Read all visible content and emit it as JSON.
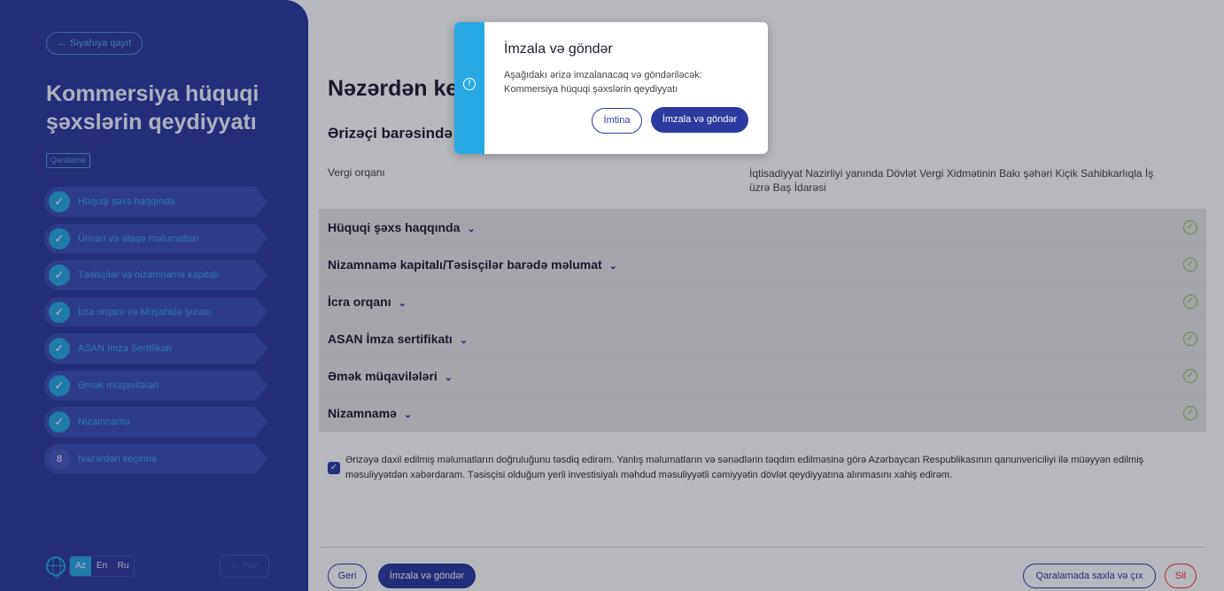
{
  "sidebar": {
    "back_label": "← Siyahıya qayıt",
    "title": "Kommersiya hüquqi şəxslərin qeydiyyatı",
    "badge": "Qaralama",
    "steps": [
      {
        "label": "Hüquqi şəxs haqqında",
        "done": true
      },
      {
        "label": "Ünvan və əlaqə məlumatları",
        "done": true
      },
      {
        "label": "Təsisçilər və nizamnamə kapitalı",
        "done": true
      },
      {
        "label": "İcra orqanı və Müşahidə şurası",
        "done": true
      },
      {
        "label": "ASAN İmza Sertifikatı",
        "done": true
      },
      {
        "label": "Əmək müqavilələri",
        "done": true
      },
      {
        "label": "Nizamnamə",
        "done": true
      },
      {
        "label": "Nəzərdən keçirmə",
        "done": false,
        "number": "8"
      }
    ],
    "languages": [
      "Az",
      "En",
      "Ru"
    ],
    "active_language": "Az",
    "feedback_label": "Rəy"
  },
  "main": {
    "page_title": "Nəzərdən keç",
    "section_title": "Ərizəçi barəsində r",
    "tax_label": "Vergi orqanı",
    "tax_value": "İqtisadiyyat Nazirliyi yanında Dövlət Vergi Xidmətinin Bakı şəhəri Kiçik Sahibkarlıqla İş üzrə Baş İdarəsi",
    "accordion": [
      {
        "title": "Hüquqi şəxs haqqında"
      },
      {
        "title": "Nizamnamə kapitalı/Təsisçilər barədə məlumat"
      },
      {
        "title": "İcra orqanı"
      },
      {
        "title": "ASAN İmza sertifikatı"
      },
      {
        "title": "Əmək müqavilələri"
      },
      {
        "title": "Nizamnamə"
      }
    ],
    "consent_text": "Ərizəyə daxil edilmiş məlumatların doğruluğunu təsdiq edirəm. Yanlış məlumatların və sənədlərin təqdim edilməsinə görə Azərbaycan Respublikasının qanunvericiliyi ilə müəyyən edilmiş məsuliyyətdən xəbərdaram. Təsisçisi olduğum yerli investisiyalı məhdud məsuliyyətli cəmiyyətin dövlət qeydiyyatına alınmasını xahiş edirəm.",
    "consent_checked": true,
    "footer": {
      "back": "Geri",
      "sign": "İmzala və göndər",
      "save_exit": "Qaralamada saxla və çıx",
      "delete": "Sil"
    }
  },
  "modal": {
    "title": "İmzala və göndər",
    "message_line1": "Aşağıdakı ərizə imzalanacaq və göndəriləcək:",
    "message_line2": "Kommersiya hüquqi şəxslərin qeydiyyatı",
    "cancel": "İmtina",
    "confirm": "İmzala və göndər"
  },
  "colors": {
    "sidebar_bg": "#2b3a9e",
    "accent": "#27aae3",
    "success": "#8bc34a",
    "danger": "#e53935"
  }
}
